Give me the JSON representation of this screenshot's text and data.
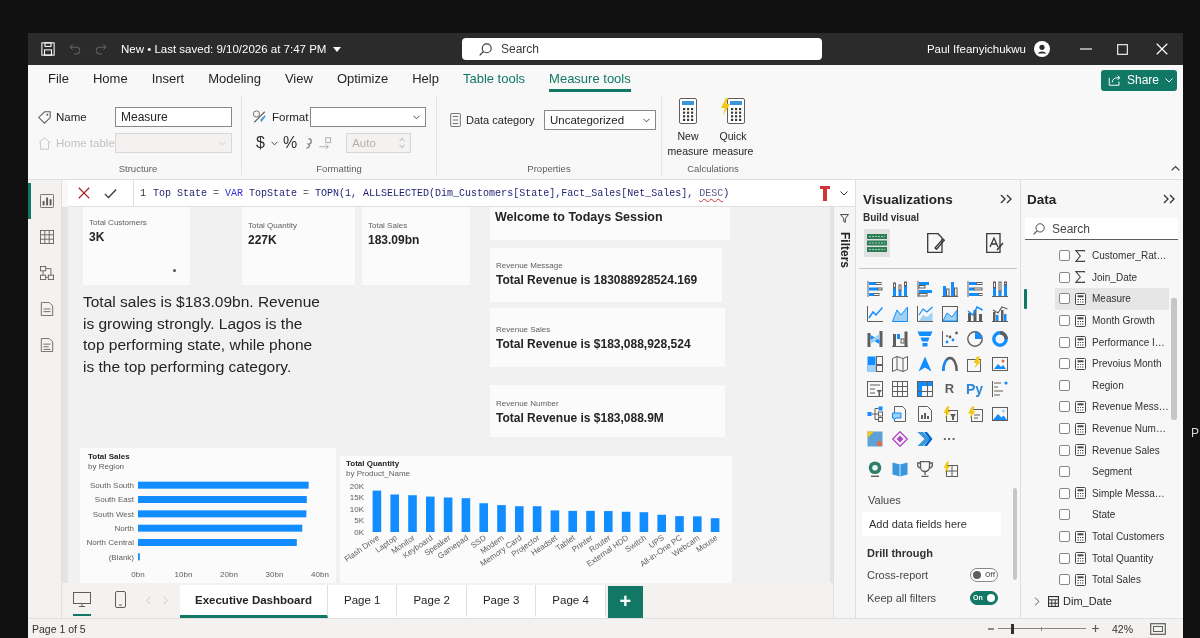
{
  "title_bar": {
    "history": [
      {
        "kind": "undo",
        "disabled": true
      },
      {
        "kind": "redo",
        "disabled": true
      }
    ],
    "document": "New • Last saved: 9/10/2026 at 7:47 PM",
    "search": {
      "placeholder": "Search"
    },
    "user": "Paul Ifeanyichukwu"
  },
  "ribbon_tabs": [
    {
      "label": "File",
      "contextual": false,
      "selected": false
    },
    {
      "label": "Home",
      "contextual": false,
      "selected": false
    },
    {
      "label": "Insert",
      "contextual": false,
      "selected": false
    },
    {
      "label": "Modeling",
      "contextual": false,
      "selected": false
    },
    {
      "label": "View",
      "contextual": false,
      "selected": false
    },
    {
      "label": "Optimize",
      "contextual": false,
      "selected": false
    },
    {
      "label": "Help",
      "contextual": false,
      "selected": false
    },
    {
      "label": "Table tools",
      "contextual": true,
      "selected": false
    },
    {
      "label": "Measure tools",
      "contextual": true,
      "selected": true
    }
  ],
  "share_button": {
    "label": "Share"
  },
  "ribbon": {
    "structure": {
      "label": "Structure",
      "name": {
        "label": "Name",
        "value": "Measure"
      },
      "home_table": {
        "label": "Home table",
        "disabled": true
      }
    },
    "formatting": {
      "label": "Formatting",
      "format": {
        "label": "Format"
      },
      "currency_button": "$",
      "percent_button": "%",
      "decimal_places": {
        "value": "Auto",
        "disabled": true
      }
    },
    "properties": {
      "label": "Properties",
      "data_category": {
        "label": "Data category",
        "value": "Uncategorized"
      }
    },
    "calculations": {
      "label": "Calculations",
      "buttons": [
        {
          "label": "New measure",
          "kind": "new"
        },
        {
          "label": "Quick measure",
          "kind": "quick"
        }
      ]
    }
  },
  "nav_rail": [
    {
      "kind": "report",
      "selected": true
    },
    {
      "kind": "table",
      "selected": false
    },
    {
      "kind": "model",
      "selected": false
    },
    {
      "kind": "dax",
      "selected": false
    },
    {
      "kind": "tmdl",
      "selected": false
    }
  ],
  "formula_bar": {
    "line_number": "1",
    "tokens": [
      {
        "text": "Top State",
        "kind": "plain"
      },
      {
        "text": " = ",
        "kind": "operator"
      },
      {
        "text": "VAR",
        "kind": "keyword"
      },
      {
        "text": " TopState",
        "kind": "plain"
      },
      {
        "text": " = ",
        "kind": "operator"
      },
      {
        "text": "TOPN(1, ALLSELECTED(Dim_Customers[State],Fact_Sales[Net_Sales], ",
        "kind": "plain"
      },
      {
        "text": "DESC",
        "kind": "error"
      },
      {
        "text": ")",
        "kind": "plain"
      }
    ]
  },
  "report": {
    "cards": [
      {
        "title": "Total Customers",
        "value": "3K"
      },
      {
        "title": "Total Quantity",
        "value": "227K"
      },
      {
        "title": "Total Sales",
        "value": "183.09bn"
      }
    ],
    "narrative": "Total sales is $183.09bn. Revenue is growing strongly. Lagos is the top performing state, while phone is the top performing category.",
    "welcome": "Welcome to Todays Session",
    "revenue_cards": [
      {
        "title": "Revenue Message",
        "value": "Total Revenue is 183088928524.169"
      },
      {
        "title": "Revenue Sales",
        "value": "Total Revenue is $183,088,928,524"
      },
      {
        "title": "Revenue Number",
        "value": "Total Revenue is $183,088.9M"
      }
    ],
    "sales_chart": {
      "subtitle": "by Region",
      "chart_data": {
        "type": "bar",
        "orientation": "horizontal",
        "title": "Total Sales",
        "categories": [
          "South South",
          "South East",
          "South West",
          "North",
          "North Central",
          "(Blank)"
        ],
        "values": [
          37.5,
          37.1,
          37.0,
          36.1,
          34.9,
          0.4
        ],
        "xlim": [
          0,
          40
        ],
        "xticks": [
          {
            "value": 0,
            "label": "0bn"
          },
          {
            "value": 10,
            "label": "10bn"
          },
          {
            "value": 20,
            "label": "20bn"
          },
          {
            "value": 30,
            "label": "30bn"
          },
          {
            "value": 40,
            "label": "40bn"
          }
        ]
      }
    },
    "quantity_chart": {
      "subtitle": "by Product_Name",
      "chart_data": {
        "type": "bar",
        "orientation": "vertical",
        "title": "Total Quantity",
        "categories": [
          "Flash Drive",
          "Laptop",
          "Monitor",
          "Keyboard",
          "Speaker",
          "Gamepad",
          "SSD",
          "Modem",
          "Memory Card",
          "Projector",
          "Headset",
          "Tablet",
          "Printer",
          "Router",
          "External HDD",
          "Switch",
          "UPS",
          "All-in-One PC",
          "Webcam",
          "Mouse"
        ],
        "values": [
          18.0,
          16.3,
          16.0,
          15.4,
          15.0,
          14.7,
          12.5,
          11.7,
          11.2,
          11.2,
          9.4,
          9.2,
          9.2,
          9.1,
          8.8,
          8.6,
          7.5,
          6.9,
          6.8,
          6.0
        ],
        "ylim": [
          0,
          20
        ],
        "yticks": [
          {
            "value": 0,
            "label": "0K"
          },
          {
            "value": 5,
            "label": "5K"
          },
          {
            "value": 10,
            "label": "10K"
          },
          {
            "value": 15,
            "label": "15K"
          },
          {
            "value": 20,
            "label": "20K"
          }
        ]
      }
    }
  },
  "view_buttons": [
    {
      "kind": "desktop",
      "selected": true
    },
    {
      "kind": "mobile",
      "selected": false
    }
  ],
  "page_nav": [
    {
      "kind": "previous",
      "disabled": true
    },
    {
      "kind": "next",
      "disabled": true
    }
  ],
  "page_tabs": [
    {
      "label": "Executive Dashboard",
      "selected": true
    },
    {
      "label": "Page 1",
      "selected": false
    },
    {
      "label": "Page 2",
      "selected": false
    },
    {
      "label": "Page 3",
      "selected": false
    },
    {
      "label": "Page 4",
      "selected": false
    }
  ],
  "add_page_button": "+",
  "filters_pane": {
    "label": "Filters"
  },
  "visualizations": {
    "title": "Visualizations",
    "section": "Build visual",
    "modes": [
      {
        "kind": "build",
        "selected": true
      },
      {
        "kind": "format",
        "selected": false
      },
      {
        "kind": "analytics",
        "selected": false
      }
    ],
    "gallery_rows": [
      [
        {
          "kind": "stacked-bar-chart"
        },
        {
          "kind": "stacked-column-chart"
        },
        {
          "kind": "clustered-bar-chart"
        },
        {
          "kind": "clustered-column-chart"
        },
        {
          "kind": "full-stacked-bar-chart"
        },
        {
          "kind": "full-stacked-column-chart"
        }
      ],
      [
        {
          "kind": "line-chart"
        },
        {
          "kind": "area-chart"
        },
        {
          "kind": "stacked-area-chart"
        },
        {
          "kind": "full-stacked-area-chart"
        },
        {
          "kind": "line-column-chart"
        },
        {
          "kind": "line-clustered-column-chart"
        }
      ],
      [
        {
          "kind": "ribbon-chart"
        },
        {
          "kind": "waterfall-chart"
        },
        {
          "kind": "funnel"
        },
        {
          "kind": "scatter-chart"
        },
        {
          "kind": "pie-chart"
        },
        {
          "kind": "donut-chart"
        }
      ],
      [
        {
          "kind": "treemap"
        },
        {
          "kind": "map"
        },
        {
          "kind": "arrow-map"
        },
        {
          "kind": "gauge"
        },
        {
          "kind": "lightning-card"
        },
        {
          "kind": "image-card"
        }
      ],
      [
        {
          "kind": "slicer"
        },
        {
          "kind": "table"
        },
        {
          "kind": "matrix"
        },
        {
          "kind": "text",
          "label": "R"
        },
        {
          "kind": "text",
          "label": "Py"
        },
        {
          "kind": "influencers"
        }
      ],
      [
        {
          "kind": "tree-diagram"
        },
        {
          "kind": "doc-chat"
        },
        {
          "kind": "report-doc"
        },
        {
          "kind": "lightning-filter"
        },
        {
          "kind": "lightning-chat"
        },
        {
          "kind": "image"
        }
      ],
      [
        {
          "kind": "colored-tile"
        },
        {
          "kind": "diamond"
        },
        {
          "kind": "chevron-pair"
        },
        {
          "kind": "text",
          "label": "···"
        }
      ],
      [
        {
          "kind": "globe"
        },
        {
          "kind": "book-map"
        },
        {
          "kind": "trophy"
        },
        {
          "kind": "lightning-table"
        }
      ]
    ],
    "values_label": "Values",
    "values_field": {
      "placeholder": "Add data fields here"
    },
    "drill_through": "Drill through",
    "toggles": [
      {
        "label": "Cross-report",
        "on": false,
        "state_label": "Off"
      },
      {
        "label": "Keep all filters",
        "on": true,
        "state_label": "On"
      }
    ]
  },
  "data_pane": {
    "title": "Data",
    "search": {
      "placeholder": "Search"
    },
    "fields": [
      {
        "label": "Customer_Rat…",
        "kind": "sum",
        "checked": false,
        "selected": false
      },
      {
        "label": "Join_Date",
        "kind": "sum",
        "checked": false,
        "selected": false
      },
      {
        "label": "Measure",
        "kind": "measure",
        "checked": false,
        "selected": true
      },
      {
        "label": "Month Growth",
        "kind": "measure",
        "checked": false,
        "selected": false
      },
      {
        "label": "Performance I…",
        "kind": "measure",
        "checked": false,
        "selected": false
      },
      {
        "label": "Prevoius Month",
        "kind": "measure",
        "checked": false,
        "selected": false
      },
      {
        "label": "Region",
        "kind": "column",
        "checked": false,
        "selected": false
      },
      {
        "label": "Revenue Mess…",
        "kind": "measure",
        "checked": false,
        "selected": false
      },
      {
        "label": "Revenue Num…",
        "kind": "measure",
        "checked": false,
        "selected": false
      },
      {
        "label": "Revenue Sales",
        "kind": "measure",
        "checked": false,
        "selected": false
      },
      {
        "label": "Segment",
        "kind": "column",
        "checked": false,
        "selected": false
      },
      {
        "label": "Simple Messa…",
        "kind": "measure",
        "checked": false,
        "selected": false
      },
      {
        "label": "State",
        "kind": "column",
        "checked": false,
        "selected": false
      },
      {
        "label": "Total Customers",
        "kind": "measure",
        "checked": false,
        "selected": false
      },
      {
        "label": "Total Quantity",
        "kind": "measure",
        "checked": false,
        "selected": false
      },
      {
        "label": "Total Sales",
        "kind": "measure",
        "checked": false,
        "selected": false
      }
    ],
    "tables": [
      {
        "label": "Dim_Date",
        "expanded": false
      }
    ]
  },
  "status_bar": {
    "page": "Page 1 of 5",
    "zoom_slider": {
      "level": 0.16
    },
    "zoom": "42%"
  },
  "edge_text": "P"
}
